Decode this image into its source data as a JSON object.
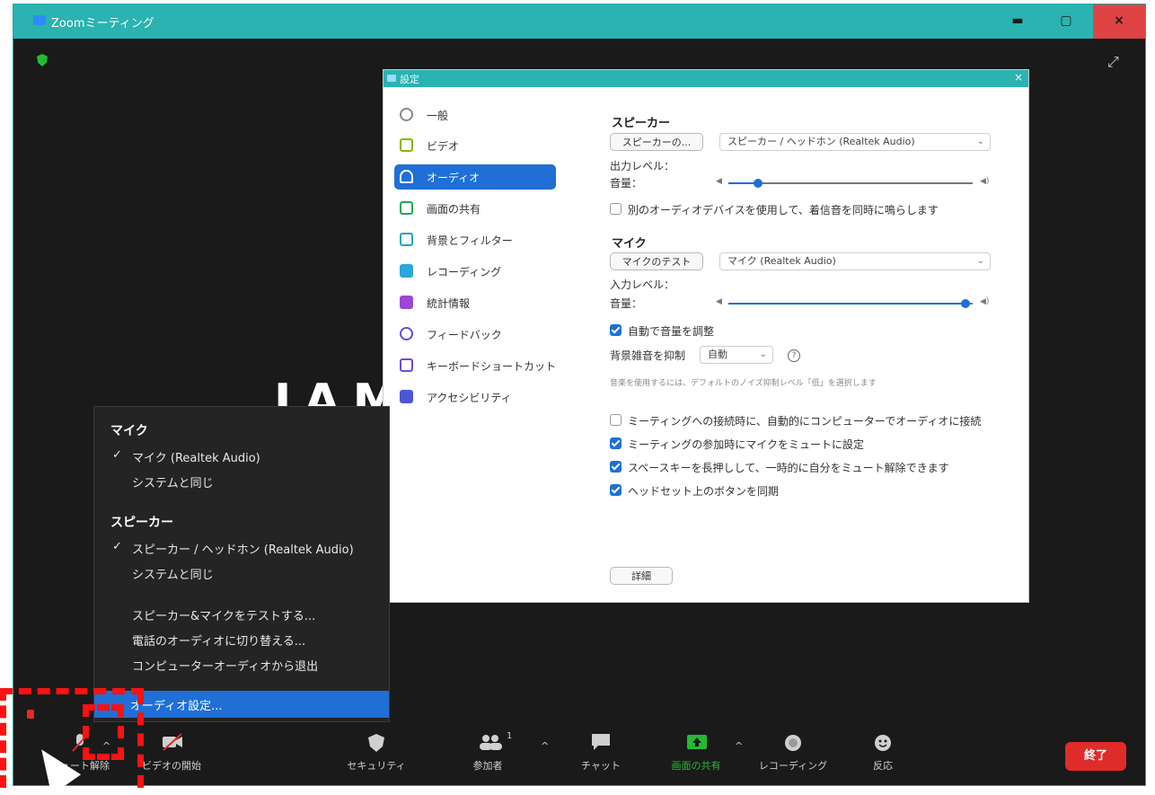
{
  "window": {
    "title": "Zoomミーティング",
    "close_glyph": "×",
    "min_glyph": "▬",
    "max_glyph": "▢",
    "fullscreen_glyph": "⤢",
    "background_text": "IAM"
  },
  "settings": {
    "title": "設定",
    "close_glyph": "×",
    "nav": [
      {
        "label": "一般",
        "icon": "gear-icon",
        "active": false
      },
      {
        "label": "ビデオ",
        "icon": "video-icon",
        "active": false
      },
      {
        "label": "オーディオ",
        "icon": "headphone-icon",
        "active": true
      },
      {
        "label": "画面の共有",
        "icon": "share-screen-icon",
        "active": false
      },
      {
        "label": "背景とフィルター",
        "icon": "background-icon",
        "active": false
      },
      {
        "label": "レコーディング",
        "icon": "record-icon",
        "active": false
      },
      {
        "label": "統計情報",
        "icon": "stats-icon",
        "active": false
      },
      {
        "label": "フィードバック",
        "icon": "feedback-icon",
        "active": false
      },
      {
        "label": "キーボードショートカット",
        "icon": "keyboard-icon",
        "active": false
      },
      {
        "label": "アクセシビリティ",
        "icon": "accessibility-icon",
        "active": false
      }
    ],
    "speaker": {
      "heading": "スピーカー",
      "test_button": "スピーカーの...",
      "device": "スピーカー / ヘッドホン (Realtek Audio)",
      "output_level_label": "出力レベル：",
      "volume_label": "音量：",
      "volume": 0.12,
      "separate_device_label": "別のオーディオデバイスを使用して、着信音を同時に鳴らします",
      "separate_device_checked": false
    },
    "mic": {
      "heading": "マイク",
      "test_button": "マイクのテスト",
      "device": "マイク (Realtek Audio)",
      "input_level_label": "入力レベル：",
      "volume_label": "音量：",
      "volume": 0.97,
      "auto_adjust_label": "自動で音量を調整",
      "auto_adjust_checked": true,
      "noise_label": "背景雑音を抑制",
      "noise_value": "自動",
      "noise_hint": "音楽を使用するには、デフォルトのノイズ抑制レベル「低」を選択します"
    },
    "options": [
      {
        "label": "ミーティングへの接続時に、自動的にコンピューターでオーディオに接続",
        "checked": false
      },
      {
        "label": "ミーティングの参加時にマイクをミュートに設定",
        "checked": true
      },
      {
        "label": "スペースキーを長押しして、一時的に自分をミュート解除できます",
        "checked": true
      },
      {
        "label": "ヘッドセット上のボタンを同期",
        "checked": true
      }
    ],
    "advanced_button": "詳細"
  },
  "audio_menu": {
    "mic_heading": "マイク",
    "mic_items": [
      {
        "label": "マイク (Realtek Audio)",
        "checked": true
      },
      {
        "label": "システムと同じ",
        "checked": false
      }
    ],
    "speaker_heading": "スピーカー",
    "speaker_items": [
      {
        "label": "スピーカー / ヘッドホン (Realtek Audio)",
        "checked": true
      },
      {
        "label": "システムと同じ",
        "checked": false
      }
    ],
    "actions": [
      "スピーカー&マイクをテストする...",
      "電話のオーディオに切り替える...",
      "コンピューターオーディオから退出"
    ],
    "selected": "オーディオ設定...",
    "check_glyph": "✓"
  },
  "toolbar": {
    "unmute": "ミュート解除",
    "video": "ビデオの開始",
    "security": "セキュリティ",
    "participants": "参加者",
    "participants_count": "1",
    "chat": "チャット",
    "share": "画面の共有",
    "record": "レコーディング",
    "reactions": "反応",
    "end": "終了",
    "caret": "^"
  },
  "colors": {
    "title_bar": "#2ab3b0",
    "accent_blue": "#1f6fd6",
    "share_green": "#22bb33",
    "end_red": "#e02b2b",
    "annotation_red": "#ff1111"
  }
}
